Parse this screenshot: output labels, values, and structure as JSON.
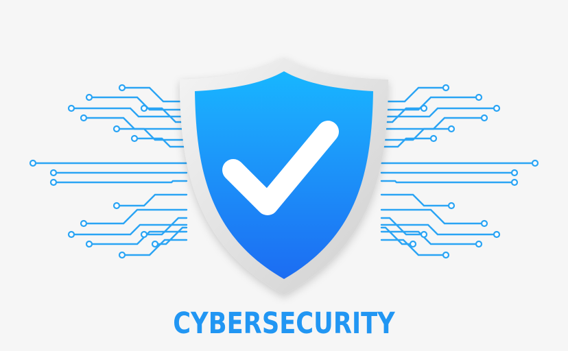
{
  "headline": "CYBERSECURITY",
  "colors": {
    "background": "#f6f6f6",
    "circuit": "#2aa4f4",
    "shield_top": "#1ab4ff",
    "shield_bottom": "#1f6ff3",
    "text": "#2196f3",
    "check": "#ffffff"
  },
  "icons": {
    "emblem": "shield-check-icon",
    "decoration": "circuit-lines"
  }
}
